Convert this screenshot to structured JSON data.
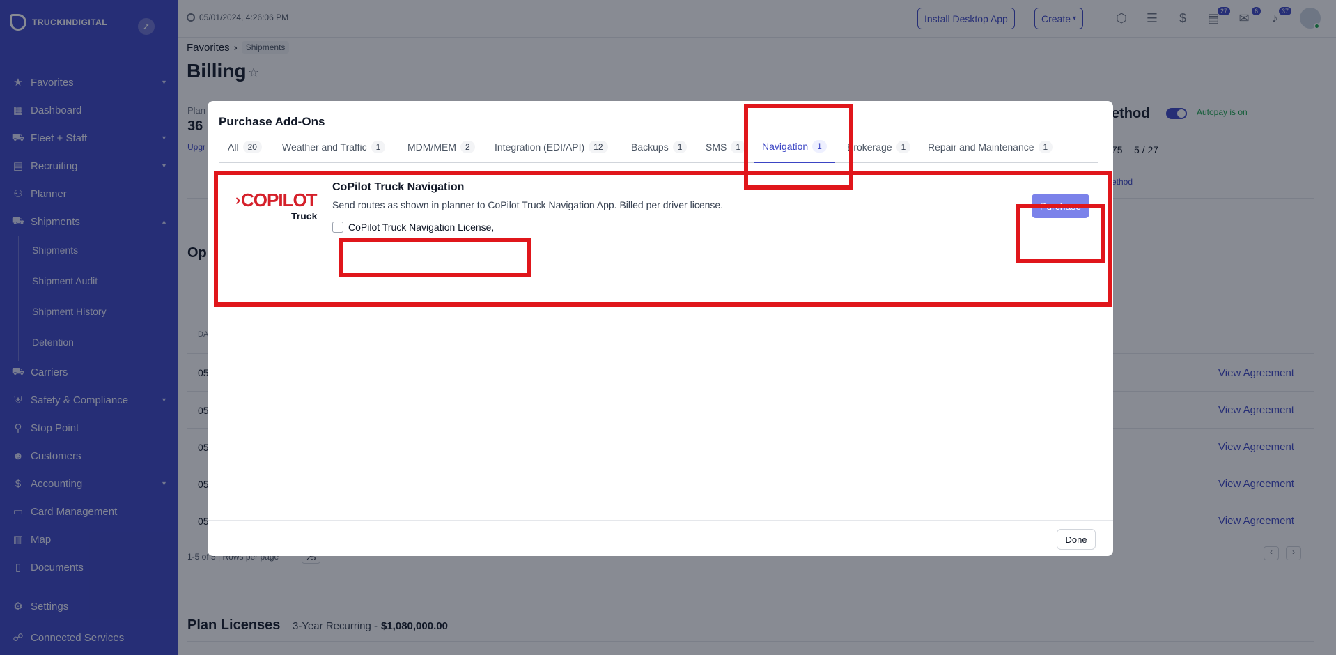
{
  "sidebar": {
    "brand": "TRUCKINDIGITAL",
    "items": [
      {
        "label": "Favorites",
        "icon": "star-icon",
        "chevron": "down"
      },
      {
        "label": "Dashboard",
        "icon": "dashboard-icon"
      },
      {
        "label": "Fleet + Staff",
        "icon": "truck-icon",
        "chevron": "down"
      },
      {
        "label": "Recruiting",
        "icon": "clipboard-icon",
        "chevron": "down"
      },
      {
        "label": "Planner",
        "icon": "route-icon"
      },
      {
        "label": "Shipments",
        "icon": "shipment-icon",
        "chevron": "up"
      },
      {
        "label": "Carriers",
        "icon": "carrier-icon"
      },
      {
        "label": "Safety & Compliance",
        "icon": "shield-icon",
        "chevron": "down"
      },
      {
        "label": "Stop Point",
        "icon": "pin-icon"
      },
      {
        "label": "Customers",
        "icon": "users-icon"
      },
      {
        "label": "Accounting",
        "icon": "dollar-icon",
        "chevron": "down"
      },
      {
        "label": "Card Management",
        "icon": "card-icon"
      },
      {
        "label": "Map",
        "icon": "map-icon"
      },
      {
        "label": "Documents",
        "icon": "document-icon"
      }
    ],
    "sub_items": [
      "Shipments",
      "Shipment Audit",
      "Shipment History",
      "Detention"
    ],
    "bottom": [
      {
        "label": "Settings",
        "icon": "gear-icon"
      },
      {
        "label": "Connected Services",
        "icon": "link-icon"
      }
    ]
  },
  "topbar": {
    "datetime": "05/01/2024, 4:26:06 PM",
    "install_label": "Install Desktop App",
    "create_label": "Create",
    "badges": [
      "27",
      "6",
      "37"
    ]
  },
  "page": {
    "breadcrumb_root": "Favorites",
    "breadcrumb_sub": "Shipments",
    "title": "Billing",
    "bg_plan_label": "Plan",
    "bg_plan_value": "36",
    "bg_upgrade": "Upgr",
    "bg_method": "ethod",
    "bg_autopay": "Autopay is on",
    "bg_counts_a": "75",
    "bg_counts_b": "5 / 27",
    "bg_method_link": "ethod",
    "bg_op": "Op",
    "bg_date_col": "DA",
    "bg_row_prefix": "05",
    "view_agreement": "View Agreement",
    "pagination": "1-5 of 5 | Rows per page",
    "rows_per_page": "25",
    "plan_licenses_title": "Plan Licenses",
    "plan_licenses_term": "3-Year Recurring -",
    "plan_licenses_amount": "$1,080,000.00"
  },
  "modal": {
    "title": "Purchase Add-Ons",
    "tabs": [
      {
        "label": "All",
        "count": "20"
      },
      {
        "label": "Weather and Traffic",
        "count": "1"
      },
      {
        "label": "MDM/MEM",
        "count": "2"
      },
      {
        "label": "Integration (EDI/API)",
        "count": "12"
      },
      {
        "label": "Backups",
        "count": "1"
      },
      {
        "label": "SMS",
        "count": "1"
      },
      {
        "label": "Navigation",
        "count": "1"
      },
      {
        "label": "Brokerage",
        "count": "1"
      },
      {
        "label": "Repair and Maintenance",
        "count": "1"
      }
    ],
    "active_tab": "Navigation",
    "addon": {
      "logo_word": "COPILOT",
      "logo_sub": "Truck",
      "name": "CoPilot Truck Navigation",
      "description": "Send routes as shown in planner to CoPilot Truck Navigation App. Billed per driver license.",
      "license_label": "CoPilot Truck Navigation License,",
      "license_checked": false,
      "purchase_label": "Purchase"
    },
    "done_label": "Done"
  },
  "colors": {
    "sidebar": "#3b45c4",
    "accent": "#3b45c4",
    "purchase": "#7b82ea",
    "highlight": "#e0161b",
    "brand_red": "#d5202a"
  }
}
